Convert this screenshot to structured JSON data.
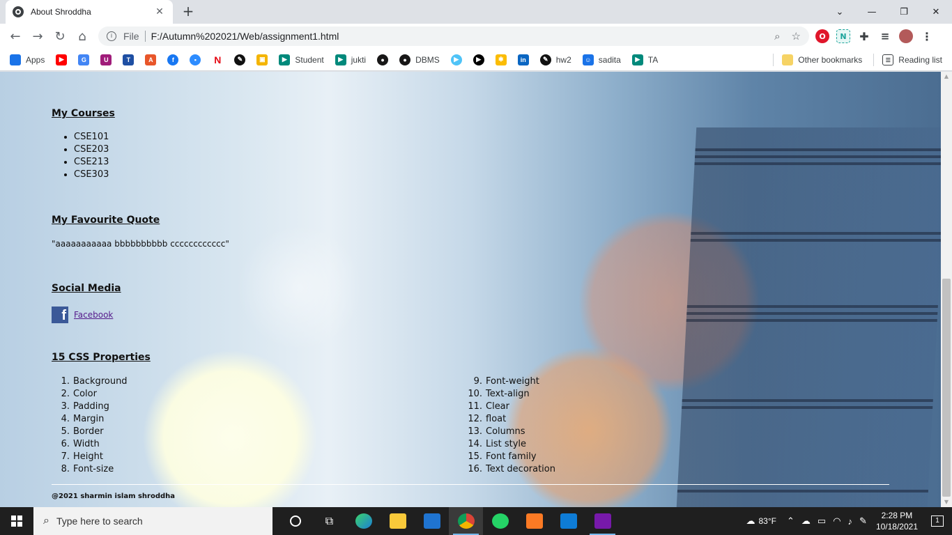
{
  "browser": {
    "tab_title": "About Shroddha",
    "tab_close": "✕",
    "new_tab": "+",
    "window_buttons": [
      "⌄",
      "—",
      "❐",
      "✕"
    ],
    "address": {
      "scheme_label": "File",
      "url": "F:/Autumn%202021/Web/assignment1.html"
    },
    "bookmarks": [
      {
        "label": "Apps",
        "color": "#1a73e8",
        "icon": "apps-grid-icon"
      },
      {
        "label": "",
        "color": "#ff0000",
        "icon": "youtube-icon"
      },
      {
        "label": "",
        "color": "#4285f4",
        "icon": "translate-icon"
      },
      {
        "label": "",
        "color": "#a01c7a",
        "icon": "uva-icon"
      },
      {
        "label": "",
        "color": "#1e4fa3",
        "icon": "t-icon"
      },
      {
        "label": "",
        "color": "#e8562a",
        "icon": "algorithm-icon"
      },
      {
        "label": "",
        "color": "#1877f2",
        "icon": "facebook-icon"
      },
      {
        "label": "",
        "color": "#2d8cff",
        "icon": "zoom-icon"
      },
      {
        "label": "",
        "color": "#e50914",
        "icon": "netflix-icon"
      },
      {
        "label": "",
        "color": "#111111",
        "icon": "pen-icon"
      },
      {
        "label": "",
        "color": "#f4b400",
        "icon": "classroom-icon"
      },
      {
        "label": "Student",
        "color": "#00897b",
        "icon": "meet-icon"
      },
      {
        "label": "jukti",
        "color": "#00897b",
        "icon": "meet-icon"
      },
      {
        "label": "",
        "color": "#181717",
        "icon": "github-icon"
      },
      {
        "label": "DBMS",
        "color": "#181717",
        "icon": "github-icon"
      },
      {
        "label": "",
        "color": "#4fc3f7",
        "icon": "play-circle-icon"
      },
      {
        "label": "",
        "color": "#000000",
        "icon": "play-icon"
      },
      {
        "label": "",
        "color": "#fbbc04",
        "icon": "pinwheel-icon"
      },
      {
        "label": "",
        "color": "#0a66c2",
        "icon": "linkedin-icon"
      },
      {
        "label": "hw2",
        "color": "#111111",
        "icon": "pen-icon"
      },
      {
        "label": "sadita",
        "color": "#1a73e8",
        "icon": "contact-icon"
      },
      {
        "label": "TA",
        "color": "#00897b",
        "icon": "meet-icon"
      }
    ],
    "other_bookmarks": "Other bookmarks",
    "reading_list": "Reading list"
  },
  "page": {
    "courses_heading": "My Courses",
    "courses": [
      "CSE101",
      "CSE203",
      "CSE213",
      "CSE303"
    ],
    "quote_heading": "My Favourite Quote",
    "quote": "\"aaaaaaaaaaa bbbbbbbbbb cccccccccccc\"",
    "social_heading": "Social Media",
    "social_icon": "f",
    "facebook_link": "Facebook",
    "css_heading": "15 CSS Properties",
    "css_left": [
      {
        "n": "1.",
        "label": "Background"
      },
      {
        "n": "2.",
        "label": "Color"
      },
      {
        "n": "3.",
        "label": "Padding"
      },
      {
        "n": "4.",
        "label": "Margin"
      },
      {
        "n": "5.",
        "label": "Border"
      },
      {
        "n": "6.",
        "label": "Width"
      },
      {
        "n": "7.",
        "label": "Height"
      },
      {
        "n": "8.",
        "label": "Font-size"
      }
    ],
    "css_right": [
      {
        "n": "9.",
        "label": "Font-weight"
      },
      {
        "n": "10.",
        "label": "Text-align"
      },
      {
        "n": "11.",
        "label": "Clear"
      },
      {
        "n": "12.",
        "label": "float"
      },
      {
        "n": "13.",
        "label": "Columns"
      },
      {
        "n": "14.",
        "label": "List style"
      },
      {
        "n": "15.",
        "label": "Font family"
      },
      {
        "n": "16.",
        "label": "Text decoration"
      }
    ],
    "footer": "@2021 sharmin islam shroddha"
  },
  "taskbar": {
    "search_placeholder": "Type here to search",
    "weather": "83°F",
    "time": "2:28 PM",
    "date": "10/18/2021",
    "notifications": "1"
  }
}
